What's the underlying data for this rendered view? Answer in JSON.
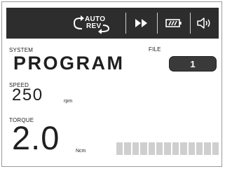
{
  "toolbar": {
    "auto_line1": "AUTO",
    "auto_line2": "REV",
    "auto_icon": "auto-reverse-icon",
    "fast_forward_icon": "fast-forward-icon",
    "battery_icon": "battery-icon",
    "volume_icon": "speaker-volume-icon"
  },
  "system": {
    "label": "SYSTEM",
    "value": "PROGRAM"
  },
  "file": {
    "label": "FILE",
    "value": "1"
  },
  "speed": {
    "label": "SPEED",
    "value": "250",
    "unit": "rpm"
  },
  "torque": {
    "label": "TORQUE",
    "value": "2.0",
    "unit": "Ncm",
    "level_fraction": 0.0,
    "segments": 13
  },
  "colors": {
    "toolbar_bg": "#2d2d2d",
    "text": "#1f1f1f",
    "bar_inactive": "#cfcfcf"
  }
}
